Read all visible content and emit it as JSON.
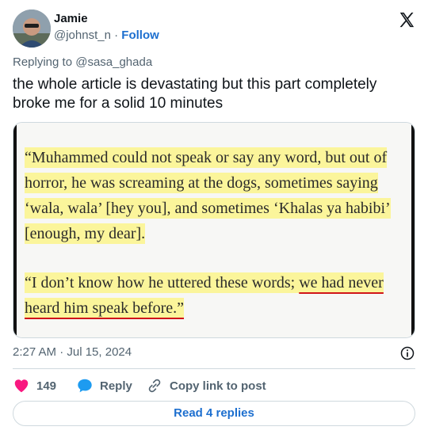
{
  "author": {
    "name": "Jamie",
    "handle": "@johnst_n",
    "separator": "·",
    "follow_label": "Follow"
  },
  "reply_context": {
    "label": "Replying to @sasa_ghada"
  },
  "tweet": {
    "text": "the whole article is devastating but this part completely broke me for a solid 10 minutes"
  },
  "media_quote": {
    "paragraph1": "“Muhammed could not speak or say any word, but out of horror, he was screaming at the dogs, sometimes saying ‘wala, wala’ [hey you], and sometimes ‘Khalas ya habibi’ [enough, my dear].",
    "paragraph2_start": "“I don’t know how he uttered these words; ",
    "paragraph2_underlined": "we had never heard him speak before.”"
  },
  "timestamp": "2:27 AM · Jul 15, 2024",
  "actions": {
    "like_count": "149",
    "reply_label": "Reply",
    "copy_label": "Copy link to post"
  },
  "read_replies_label": "Read 4 replies",
  "colors": {
    "accent": "#1d6fcf",
    "like": "#f91880",
    "highlight": "#fbf59b",
    "underline": "#d0151a"
  },
  "icons": [
    "x-logo-icon",
    "info-icon",
    "heart-icon",
    "speech-bubble-icon",
    "link-icon"
  ]
}
